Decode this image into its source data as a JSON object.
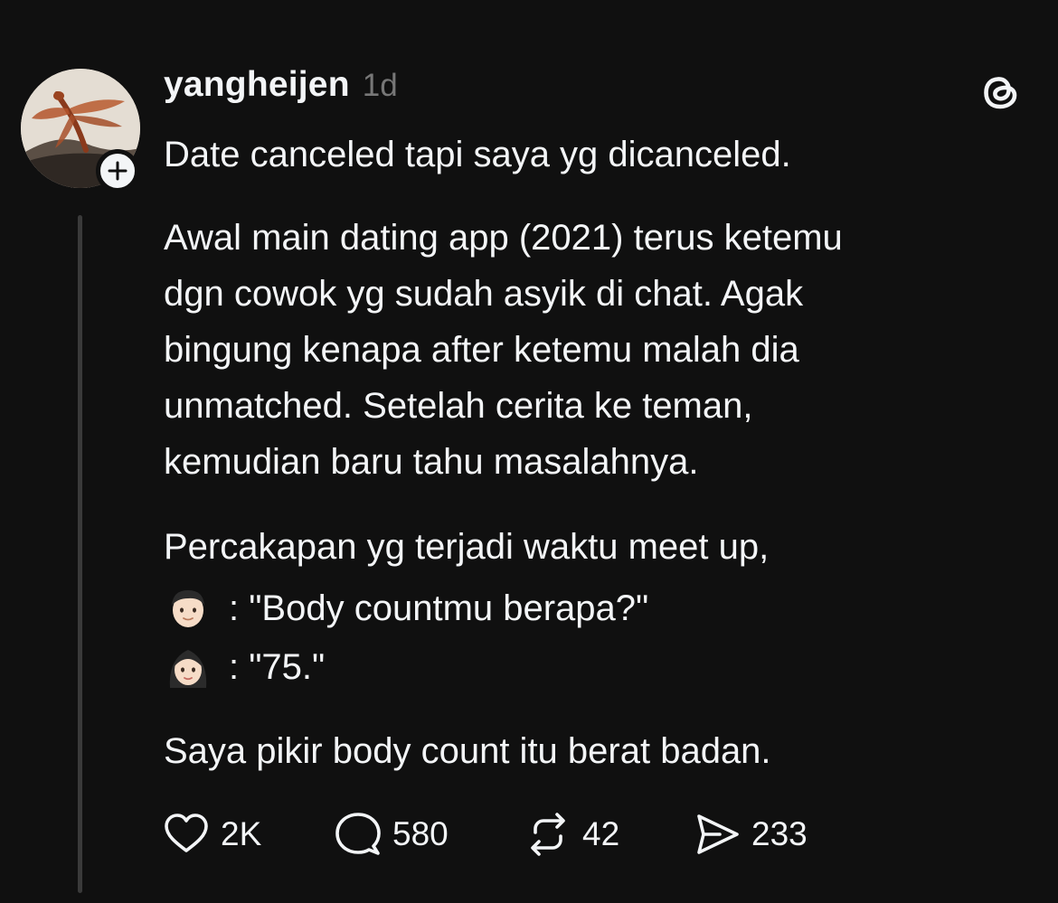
{
  "post": {
    "username": "yangheijen",
    "timestamp": "1d",
    "paragraphs": {
      "p1": "Date canceled tapi saya yg dicanceled.",
      "p2_lines": [
        "Awal main dating app (2021) terus ketemu",
        "dgn cowok yg sudah asyik di chat. Agak",
        "bingung kenapa after ketemu malah dia",
        "unmatched. Setelah cerita ke teman,",
        "kemudian baru tahu masalahnya."
      ],
      "p3": "Percakapan yg terjadi waktu meet up,",
      "dialog": [
        {
          "speaker_icon": "man-emoji-icon",
          "text": ": \"Body countmu berapa?\""
        },
        {
          "speaker_icon": "woman-emoji-icon",
          "text": ": \"75.\""
        }
      ],
      "p4": "Saya pikir body count itu berat badan."
    },
    "actions": {
      "likes": "2K",
      "replies": "580",
      "reposts": "42",
      "shares": "233"
    }
  },
  "colors": {
    "background": "#101010",
    "text": "#f3f5f7",
    "muted": "#777777",
    "thread_line": "#3a3a3a"
  },
  "icons": [
    "plus-icon",
    "threads-logo-icon",
    "heart-icon",
    "comment-icon",
    "repost-icon",
    "share-icon"
  ]
}
